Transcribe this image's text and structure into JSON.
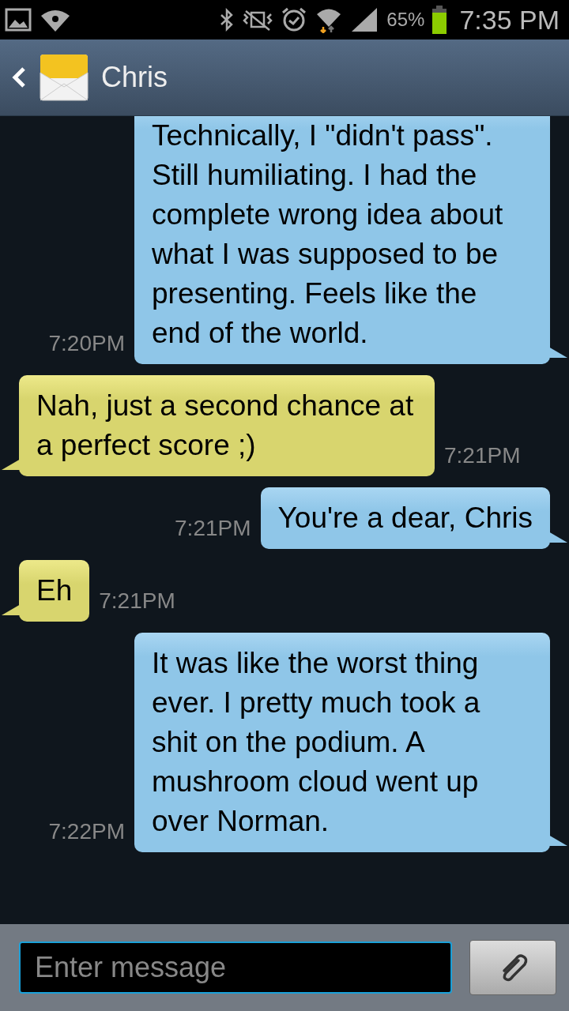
{
  "status_bar": {
    "battery": "65%",
    "time": "7:35 PM"
  },
  "header": {
    "title": "Chris"
  },
  "messages": [
    {
      "kind": "sent",
      "text": "Technically, I \"didn't pass\". Still humiliating. I had the complete wrong idea about what I was supposed to be presenting. Feels like the end of the world.",
      "time": "7:20PM"
    },
    {
      "kind": "received",
      "text": "Nah, just a second chance at a perfect score ;)",
      "time": "7:21PM"
    },
    {
      "kind": "sent",
      "text": "You're a dear, Chris",
      "time": "7:21PM"
    },
    {
      "kind": "received",
      "text": "Eh",
      "time": "7:21PM"
    },
    {
      "kind": "sent",
      "text": "It was like the worst thing ever. I pretty much took a shit on the podium. A mushroom cloud went up over Norman.",
      "time": "7:22PM"
    }
  ],
  "composer": {
    "placeholder": "Enter message"
  }
}
